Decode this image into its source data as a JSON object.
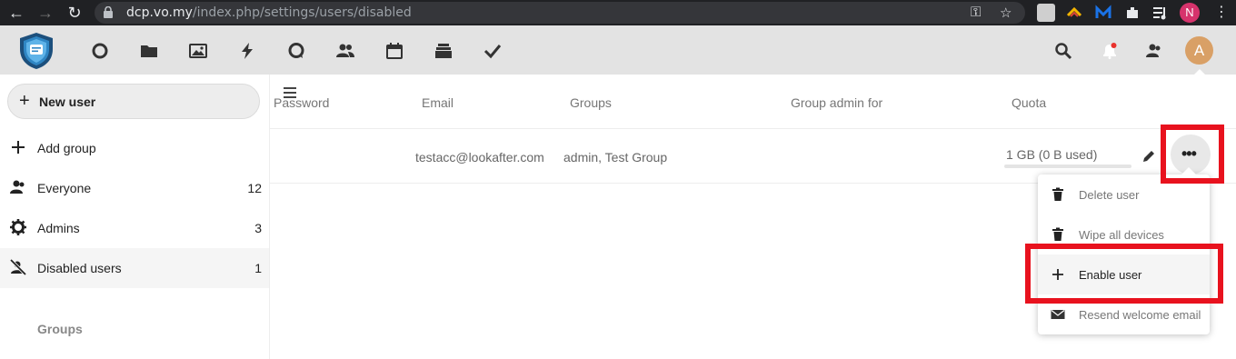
{
  "browser": {
    "url_host": "dcp.vo.my",
    "url_path": "/index.php/settings/users/disabled",
    "profile_initial": "N",
    "nav_icons": [
      "back-arrow-icon",
      "forward-arrow-icon",
      "reload-icon"
    ]
  },
  "header": {
    "apps": [
      "dashboard-icon",
      "files-icon",
      "photos-icon",
      "activity-icon",
      "talk-icon",
      "contacts-icon",
      "calendar-icon",
      "deck-icon",
      "tasks-icon"
    ],
    "avatar_initial": "A"
  },
  "sidebar": {
    "new_user_label": "New user",
    "add_group_label": "Add group",
    "items": [
      {
        "label": "Everyone",
        "count": "12"
      },
      {
        "label": "Admins",
        "count": "3"
      },
      {
        "label": "Disabled users",
        "count": "1"
      }
    ],
    "groups_caption": "Groups"
  },
  "table": {
    "headers": {
      "password": "Password",
      "email": "Email",
      "groups": "Groups",
      "group_admin_for": "Group admin for",
      "quota": "Quota"
    },
    "rows": [
      {
        "email": "testacc@lookafter.com",
        "groups": "admin, Test Group",
        "quota": "1 GB (0 B used)",
        "quota_used_fraction": 0.0
      }
    ]
  },
  "menu": {
    "items": [
      {
        "label": "Delete user",
        "icon": "trash-icon"
      },
      {
        "label": "Wipe all devices",
        "icon": "trash-icon"
      },
      {
        "label": "Enable user",
        "icon": "plus-icon"
      },
      {
        "label": "Resend welcome email",
        "icon": "envelope-icon"
      }
    ]
  },
  "colors": {
    "accent_annotation": "#e8121e",
    "avatar": "#d9a066",
    "header_bg": "#e3e3e3"
  }
}
